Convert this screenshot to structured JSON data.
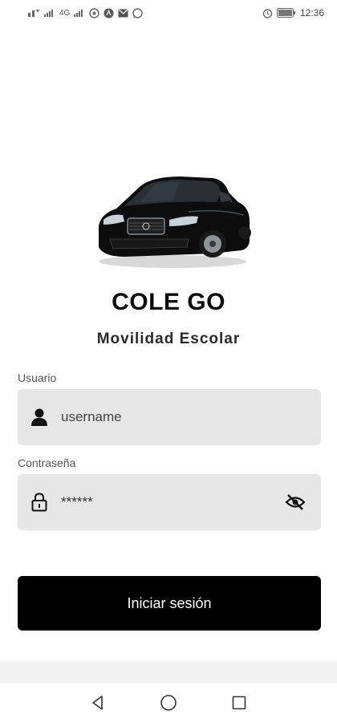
{
  "status_bar": {
    "left_text": "4G",
    "right_time": "12:36",
    "icons": [
      "network-speed-icon",
      "signal-icon",
      "signal-icon",
      "hotspot-icon",
      "app-icon",
      "mail-icon",
      "whatsapp-icon",
      "alarm-icon",
      "battery-icon"
    ]
  },
  "app": {
    "title": "COLE GO",
    "subtitle": "Movilidad Escolar"
  },
  "form": {
    "username": {
      "label": "Usuario",
      "placeholder": "username",
      "value": ""
    },
    "password": {
      "label": "Contraseña",
      "value": "******"
    },
    "submit_label": "Iniciar sesión"
  },
  "nav": [
    "back",
    "home",
    "recents"
  ]
}
